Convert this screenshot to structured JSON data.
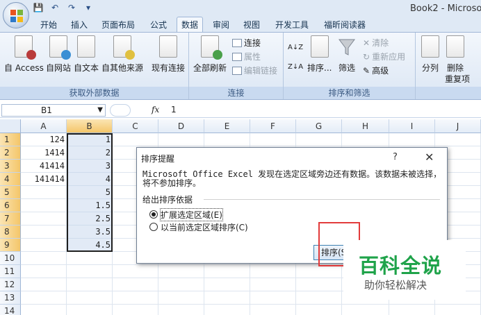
{
  "window": {
    "title": "Book2 - Microso"
  },
  "tabs": [
    "开始",
    "插入",
    "页面布局",
    "公式",
    "数据",
    "审阅",
    "视图",
    "开发工具",
    "福昕阅读器"
  ],
  "active_tab": "数据",
  "ribbon": {
    "external": {
      "label": "获取外部数据",
      "buttons": [
        "自 Access",
        "自网站",
        "自文本",
        "自其他来源",
        "现有连接"
      ]
    },
    "connections": {
      "label": "连接",
      "refresh": "全部刷新",
      "connections": "连接",
      "properties": "属性",
      "edit_links": "编辑链接"
    },
    "sort_filter": {
      "label": "排序和筛选",
      "sort": "排序...",
      "filter": "筛选",
      "clear": "清除",
      "reapply": "重新应用",
      "advanced": "高级"
    },
    "tools": {
      "split": "分列",
      "remove_dup_1": "删除",
      "remove_dup_2": "重复项"
    }
  },
  "formula_bar": {
    "name_box": "B1",
    "fx": "fx",
    "value": "1"
  },
  "columns": [
    "A",
    "B",
    "C",
    "D",
    "E",
    "F",
    "G",
    "H",
    "I",
    "J"
  ],
  "rows": [
    "1",
    "2",
    "3",
    "4",
    "5",
    "6",
    "7",
    "8",
    "9",
    "10",
    "11",
    "12",
    "13",
    "14"
  ],
  "cells": {
    "A": [
      "124",
      "1414",
      "41414",
      "141414"
    ],
    "B": [
      "1",
      "2",
      "3",
      "4",
      "5",
      "1.5",
      "2.5",
      "3.5",
      "4.5"
    ]
  },
  "dialog": {
    "title": "排序提醒",
    "help": "?",
    "close": "✕",
    "message": "Microsoft Office Excel 发现在选定区域旁边还有数据。该数据未被选择，将不参加排序。",
    "section": "给出排序依据",
    "option_expand": "扩展选定区域(E)",
    "option_current": "以当前选定区域排序(C)",
    "sort_button": "排序(S)"
  },
  "watermark": {
    "title": "百科全说",
    "subtitle": "助你轻松解决"
  }
}
